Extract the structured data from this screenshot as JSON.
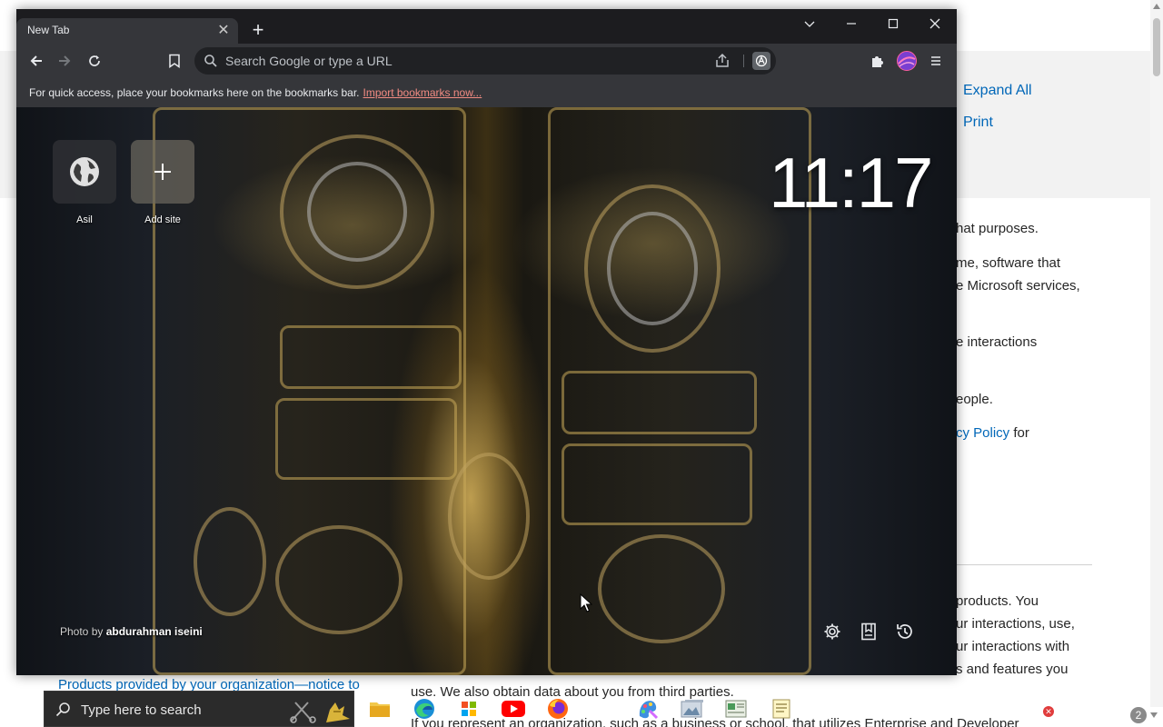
{
  "background_page": {
    "expand_all": "Expand All",
    "print": "Print",
    "lines": [
      "hat purposes.",
      "me, software that",
      "e Microsoft services,",
      "e interactions",
      "eople."
    ],
    "privacy_link": "cy Policy",
    "privacy_suffix": " for",
    "lower_lines": [
      "products. You",
      "ur interactions, use,",
      "ur interactions with",
      "s and features you"
    ],
    "bottom_link": "Products provided by your organization—notice to",
    "bottom_line": "use. We also obtain data about you from third parties.",
    "bottom_line2": "If you represent an organization, such as a business or school, that utilizes Enterprise and Developer"
  },
  "browser": {
    "tab_title": "New Tab",
    "omnibox_placeholder": "Search Google or type a URL",
    "bookmarks_bar_text": "For quick access, place your bookmarks here on the bookmarks bar.",
    "bookmarks_import_link": "Import bookmarks now..."
  },
  "new_tab_page": {
    "shortcuts": [
      {
        "label": "Asil",
        "icon": "globe-icon"
      },
      {
        "label": "Add site",
        "icon": "plus-icon"
      }
    ],
    "clock": "11:17",
    "photo_credit_prefix": "Photo by ",
    "photo_credit_author": "abdurahman iseini"
  },
  "taskbar": {
    "search_placeholder": "Type here to search",
    "notification_count": "2",
    "apps": [
      "file-explorer-icon",
      "edge-icon",
      "microsoft-store-icon",
      "youtube-icon",
      "firefox-icon",
      "paint-icon",
      "photos-icon",
      "app-icon",
      "notepad-icon"
    ]
  },
  "colors": {
    "window_bg": "#202124",
    "toolbar_bg": "#35363a",
    "link": "#0067b8",
    "import_link": "#f28b82"
  }
}
